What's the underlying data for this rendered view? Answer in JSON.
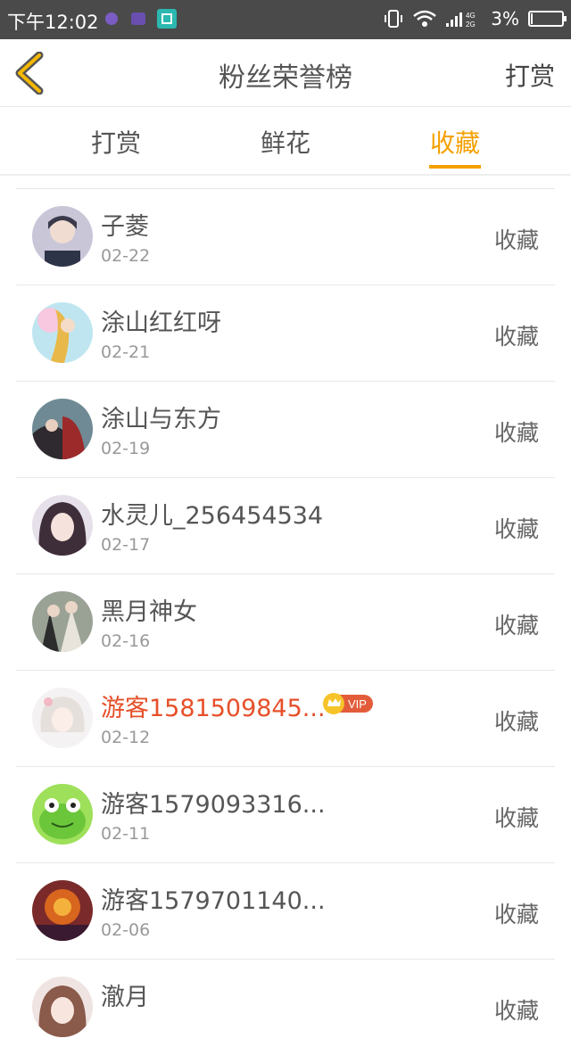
{
  "status_bar": {
    "time": "下午12:02",
    "network": "4G 2G",
    "battery": "3%"
  },
  "header": {
    "title": "粉丝荣誉榜",
    "right_label": "打赏"
  },
  "tabs": [
    {
      "label": "打赏",
      "active": false
    },
    {
      "label": "鲜花",
      "active": false
    },
    {
      "label": "收藏",
      "active": true
    }
  ],
  "colors": {
    "accent": "#f5a000",
    "vip_name": "#e6502a",
    "status_bar": "#4a4a4a"
  },
  "fans": [
    {
      "name": "子菱",
      "date": "02-22",
      "action": "收藏",
      "vip": false
    },
    {
      "name": "涂山红红呀",
      "date": "02-21",
      "action": "收藏",
      "vip": false
    },
    {
      "name": "涂山与东方",
      "date": "02-19",
      "action": "收藏",
      "vip": false
    },
    {
      "name": "水灵儿_256454534",
      "date": "02-17",
      "action": "收藏",
      "vip": false
    },
    {
      "name": "黑月神女",
      "date": "02-16",
      "action": "收藏",
      "vip": false
    },
    {
      "name": "游客1581509845...",
      "date": "02-12",
      "action": "收藏",
      "vip": true,
      "vip_label": "VIP"
    },
    {
      "name": "游客1579093316...",
      "date": "02-11",
      "action": "收藏",
      "vip": false
    },
    {
      "name": "游客1579701140...",
      "date": "02-06",
      "action": "收藏",
      "vip": false
    },
    {
      "name": "澈月",
      "date": "",
      "action": "收藏",
      "vip": false
    }
  ]
}
